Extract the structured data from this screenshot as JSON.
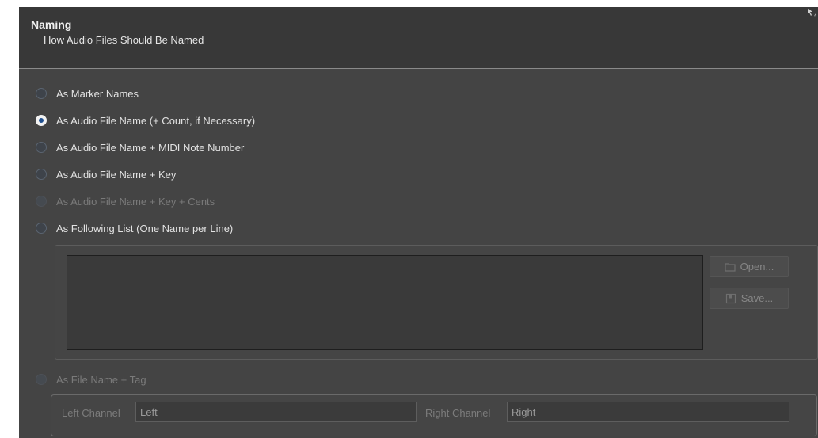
{
  "header": {
    "title": "Naming",
    "subtitle": "How Audio Files Should Be Named",
    "help_icon": "help-cursor-icon"
  },
  "options": [
    {
      "label": "As Marker Names",
      "checked": false,
      "disabled": false
    },
    {
      "label": "As Audio File Name (+ Count, if Necessary)",
      "checked": true,
      "disabled": false
    },
    {
      "label": "As Audio File Name + MIDI Note Number",
      "checked": false,
      "disabled": false
    },
    {
      "label": "As Audio File Name + Key",
      "checked": false,
      "disabled": false
    },
    {
      "label": "As Audio File Name + Key + Cents",
      "checked": false,
      "disabled": true
    },
    {
      "label": "As Following List (One Name per Line)",
      "checked": false,
      "disabled": false
    }
  ],
  "list": {
    "text": "",
    "open_label": "Open...",
    "save_label": "Save...",
    "open_icon": "folder-icon",
    "save_icon": "save-icon"
  },
  "tag_option": {
    "label": "As File Name + Tag",
    "checked": false,
    "disabled": true
  },
  "tag_fields": {
    "left_label": "Left Channel",
    "left_value": "Left",
    "right_label": "Right Channel",
    "right_value": "Right"
  }
}
